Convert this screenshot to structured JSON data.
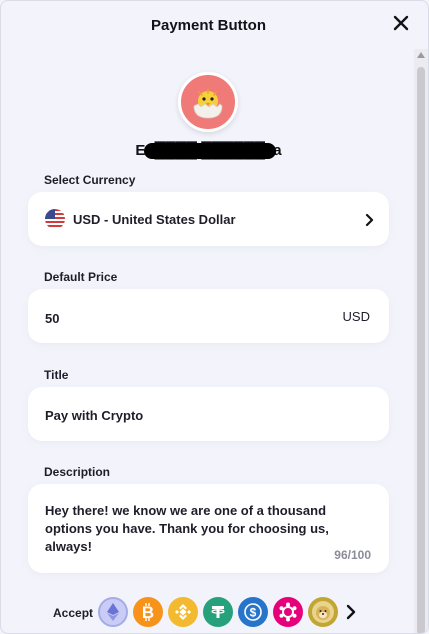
{
  "header": {
    "title": "Payment Button"
  },
  "profile": {
    "name": "En████ ██████ya"
  },
  "currency": {
    "label": "Select Currency",
    "value": "USD - United States Dollar",
    "flag_icon": "us-flag-icon"
  },
  "price": {
    "label": "Default Price",
    "value": "50",
    "unit": "USD"
  },
  "title_field": {
    "label": "Title",
    "value": "Pay with Crypto"
  },
  "description": {
    "label": "Description",
    "value": "Hey there! we know we are one of a thousand options you have. Thank you for choosing us, always!",
    "counter": "96/100"
  },
  "accept": {
    "label": "Accept",
    "coins": [
      {
        "name": "ethereum-icon",
        "color": "#c9cdf5"
      },
      {
        "name": "bitcoin-icon",
        "color": "#f7931a"
      },
      {
        "name": "binance-icon",
        "color": "#f3ba2f"
      },
      {
        "name": "tether-icon",
        "color": "#26a17b"
      },
      {
        "name": "usdc-icon",
        "color": "#2775ca"
      },
      {
        "name": "polkadot-icon",
        "color": "#e6007a"
      },
      {
        "name": "dogecoin-icon",
        "color": "#c2a633"
      }
    ]
  },
  "colors": {
    "avatar_bg": "#ef7a78",
    "background": "#f3f4fb",
    "field_bg": "#ffffff"
  }
}
